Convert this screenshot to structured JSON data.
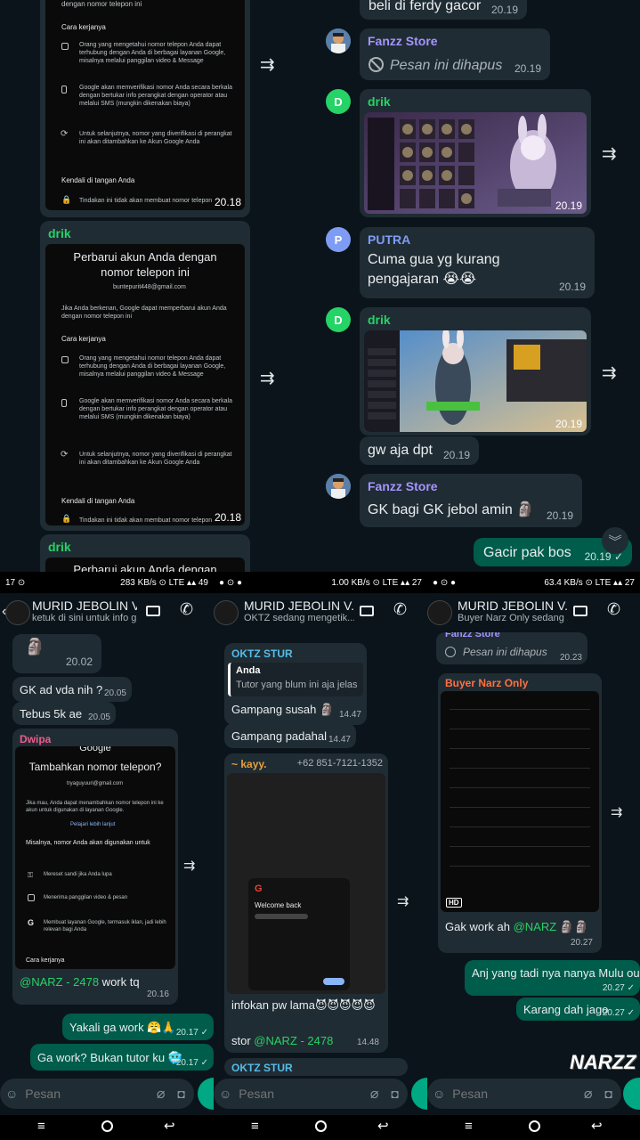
{
  "top": {
    "left_msgs": {
      "guide_card_1": {
        "section_how": "Cara kerjanya",
        "item1": "Orang yang mengetahui nomor telepon Anda dapat terhubung dengan Anda di berbagai layanan Google, misalnya melalui panggilan video & Message",
        "item2": "Google akan memverifikasi nomor Anda secara berkala dengan bertukar info perangkat dengan operator atau melalui SMS (mungkin dikenakan biaya)",
        "item3": "Untuk selanjutnya, nomor yang diverifikasi di perangkat ini akan ditambahkan ke Akun Google Anda",
        "section_control": "Kendali di tangan Anda",
        "control_text": "Tindakan ini tidak akan membuat nomor telepon",
        "top_text": "dengan nomor telepon ini",
        "time": "20.18"
      },
      "guide_card_2": {
        "sender": "drik",
        "heading": "Perbarui akun Anda dengan nomor telepon ini",
        "email": "buntepurit448@gmail.com",
        "intro": "Jika Anda berkenan, Google dapat memperbarui akun Anda dengan nomor telepon ini",
        "section_how": "Cara kerjanya",
        "item1": "Orang yang mengetahui nomor telepon Anda dapat terhubung dengan Anda di berbagai layanan Google, misalnya melalui panggilan video & Message",
        "item2": "Google akan memverifikasi nomor Anda secara berkala dengan bertukar info perangkat dengan operator atau melalui SMS (mungkin dikenakan biaya)",
        "item3": "Untuk selanjutnya, nomor yang diverifikasi di perangkat ini akan ditambahkan ke Akun Google Anda",
        "section_control": "Kendali di tangan Anda",
        "control_text": "Tindakan ini tidak akan membuat nomor telepon",
        "time": "20.18"
      },
      "guide_card_3": {
        "sender": "drik",
        "heading_partial": "Perbarui akun Anda dengan"
      }
    },
    "right_msgs": {
      "m0": {
        "text": "beli di ferdy gacor",
        "time": "20.19"
      },
      "m1": {
        "sender": "Fanzz Store",
        "deleted": "Pesan ini dihapus",
        "time": "20.19"
      },
      "m2": {
        "sender": "drik",
        "avatar": "D",
        "time": "20.19"
      },
      "m3": {
        "sender": "PUTRA",
        "avatar": "P",
        "text": "Cuma gua yg kurang pengajaran 😭😭",
        "time": "20.19"
      },
      "m4": {
        "sender": "drik",
        "avatar": "D",
        "time": "20.19",
        "caption": "gw aja dpt",
        "caption_time": "20.19"
      },
      "m5": {
        "sender": "Fanzz Store",
        "text": "GK bagi GK jebol amin 🗿",
        "time": "20.19"
      },
      "m6": {
        "text": "Gacir pak bos",
        "time": "20.19 ✓"
      }
    }
  },
  "panels": [
    {
      "status_left": "17 ⊙",
      "status_right": "283 KB/s ⊙ LTE ▴▴ 49",
      "title": "MURID JEBOLIN V...",
      "subtitle": "ketuk di sini untuk info gr...",
      "msgs": {
        "a": {
          "time": "20.02"
        },
        "b": {
          "text": "GK ad vda nih ?",
          "time": "20.05"
        },
        "c": {
          "text": "Tebus 5k ae",
          "time": "20.05"
        },
        "d": {
          "sender": "Dwipa",
          "google_brand": "Google",
          "heading": "Tambahkan nomor telepon?",
          "email": "tryaguyuuri@gmail.com",
          "intro": "Jika mau, Anda dapat menambahkan nomor telepon ini ke akun untuk digunakan di layanan Google.",
          "link": "Pelajari lebih lanjut",
          "subhead": "Misalnya, nomor Anda akan digunakan untuk",
          "item1": "Mereset sandi jika Anda lupa",
          "item2": "Menerima panggilan video & pesan",
          "item3": "Membuat layanan Google, termasuk iklan, jadi lebih relevan bagi Anda",
          "section": "Cara kerjanya",
          "mention": "@NARZ - 2478",
          "text": " work tq",
          "time": "20.16"
        },
        "e": {
          "text": "Yakali ga work 😤🙏",
          "time": "20.17 ✓"
        },
        "f": {
          "text": "Ga work? Bukan tutor ku 🥶",
          "time": "20.17 ✓"
        }
      },
      "placeholder": "Pesan"
    },
    {
      "status_left": "● ⊙ ●",
      "status_right": "1.00 KB/s ⊙ LTE ▴▴ 27",
      "title": "MURID JEBOLIN V...",
      "subtitle": "OKTZ sedang mengetik...",
      "msgs": {
        "a": {
          "sender": "OKTZ STUR",
          "quote_name": "Anda",
          "quote_text": "Tutor yang blum ini aja jelas",
          "text": "Gampang susah 🗿",
          "time": "14.47"
        },
        "b": {
          "text": "Gampang padahal",
          "time": "14.47"
        },
        "c": {
          "sender": "~ kayy.",
          "phone": "+62 851-7121-1352",
          "welcome": "Welcome back",
          "text": "infokan pw lama😈😈😈😈😈",
          "stor": "stor ",
          "mention": "@NARZ - 2478",
          "time": "14.48"
        },
        "d": {
          "sender": "OKTZ STUR"
        }
      },
      "placeholder": "Pesan"
    },
    {
      "status_left": "● ⊙ ●",
      "status_right": "63.4 KB/s ⊙ LTE ▴▴ 27",
      "title": "MURID JEBOLIN V...",
      "subtitle": "Buyer Narz Only sedang ...",
      "msgs": {
        "a": {
          "sender": "Fanzz Store",
          "deleted": "Pesan ini dihapus",
          "time": "20.23"
        },
        "b": {
          "sender": "Buyer Narz Only",
          "hd": "HD",
          "text": "Gak work ah ",
          "mention": "@NARZ",
          "emoji": " 🗿🗿",
          "time": "20.27"
        },
        "c": {
          "text": "Anj yang tadi nya nanya Mulu ouq",
          "time": "20.27 ✓"
        },
        "d": {
          "text": "Karang dah jago",
          "time": "20.27 ✓"
        }
      },
      "placeholder": "Pesan",
      "watermark": "NARZZ"
    }
  ],
  "colors": {
    "bg": "#0b141a",
    "bubble_in": "#202c33",
    "bubble_out": "#005c4b",
    "drik": "#25d366",
    "fanzz": "#a495ff",
    "putra": "#7f9cf5",
    "dwipa": "#ef5b8c",
    "oktz": "#53bdeb",
    "kayy": "#e8a03a",
    "buyer": "#ff7043"
  }
}
